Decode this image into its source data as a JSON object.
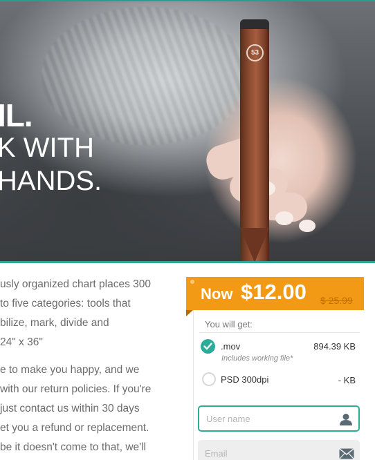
{
  "hero": {
    "line1": "IL.",
    "line2": "K WITH",
    "line3": " HANDS.",
    "pencil_logo": "53"
  },
  "description": {
    "paragraphs": [
      [
        "usly organized chart places 300",
        " to five categories: tools that",
        "bilize, mark, divide and",
        "24\" x 36\""
      ],
      [
        "e to make you happy, and we",
        " with our return policies. If you're",
        "just contact us within 30 days",
        "et you a refund or replacement.",
        "be it doesn't come to that, we'll"
      ]
    ]
  },
  "purchase": {
    "now_label": "Now",
    "price": "$12.00",
    "old_price": "$ 25.99",
    "you_will_get": "You will get:",
    "options": [
      {
        "name": ".mov",
        "subtitle": "Includes working file*",
        "size": "894.39 KB",
        "selected": true
      },
      {
        "name": "PSD 300dpi",
        "subtitle": "",
        "size": "- KB",
        "selected": false
      }
    ],
    "username_placeholder": "User name",
    "email_placeholder": "Email"
  },
  "colors": {
    "accent": "#2bab98",
    "price_banner": "#f29a16"
  },
  "icons": {
    "check": "check-icon",
    "user": "user-icon",
    "email": "envelope-icon"
  }
}
